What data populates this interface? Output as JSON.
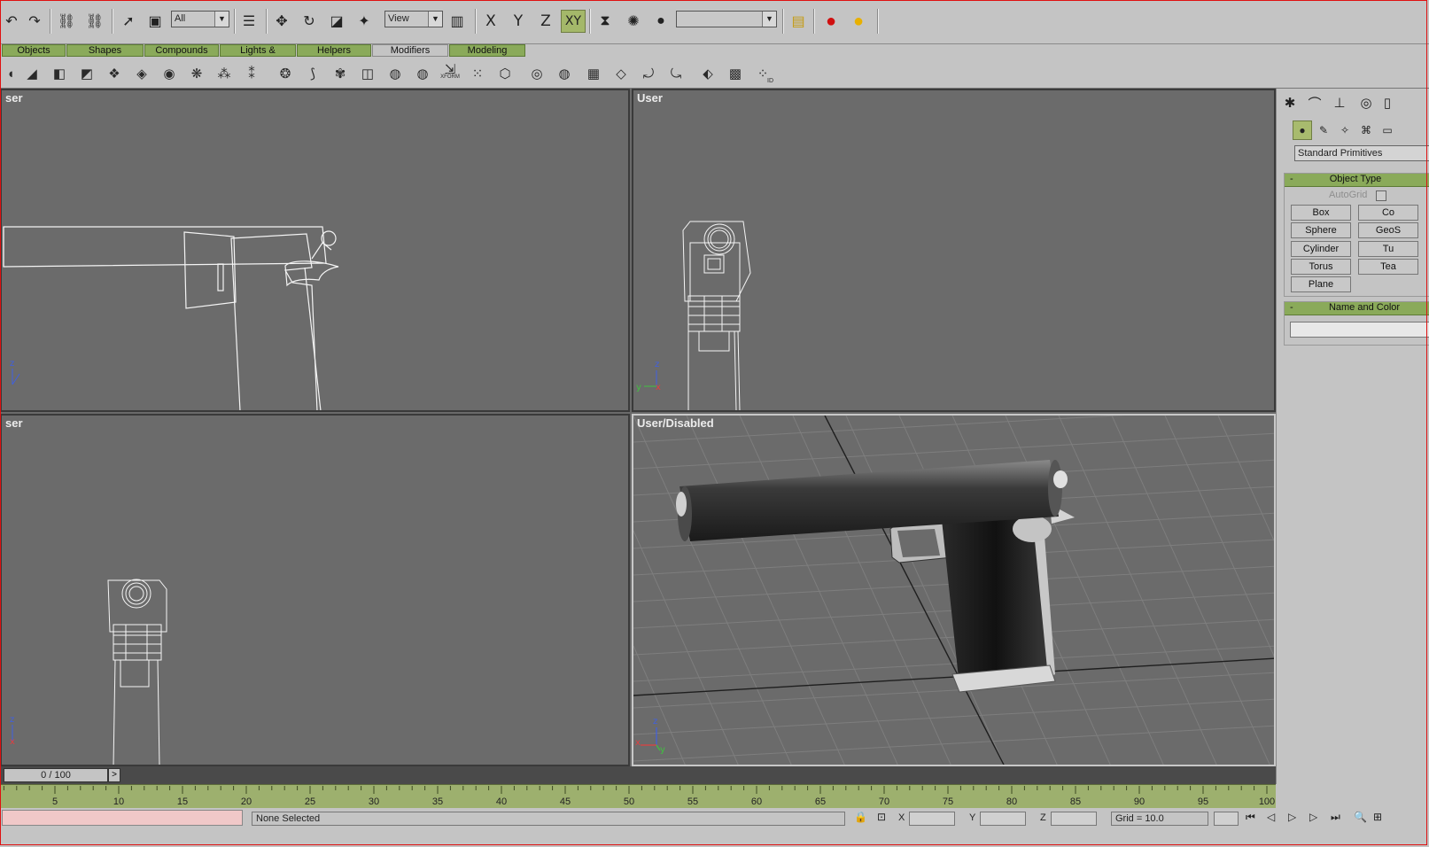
{
  "toolbar": {
    "selection_filter": "All",
    "coord_system": "View",
    "axis_x": "X",
    "axis_y": "Y",
    "axis_z": "Z",
    "axis_xy": "XY",
    "named_selection": ""
  },
  "tabs": [
    {
      "label": "Objects"
    },
    {
      "label": "Shapes"
    },
    {
      "label": "Compounds"
    },
    {
      "label": "Lights & Cameras"
    },
    {
      "label": "Helpers"
    },
    {
      "label": "Modifiers"
    },
    {
      "label": "Modeling"
    }
  ],
  "shelf": {
    "xform_label": "XFORM",
    "id_label": "ID"
  },
  "viewports": {
    "top_left": {
      "label": "ser"
    },
    "top_right": {
      "label": "User"
    },
    "bottom_left": {
      "label": "ser"
    },
    "bottom_right": {
      "label": "User/Disabled"
    }
  },
  "gizmo": {
    "x": "x",
    "y": "y",
    "z": "z"
  },
  "command_panel": {
    "primitive_type": "Standard Primitives",
    "object_type": {
      "title": "Object Type",
      "collapse": "-",
      "autogrid": "AutoGrid",
      "buttons": [
        "Box",
        "Co",
        "Sphere",
        "GeoS",
        "Cylinder",
        "Tu",
        "Torus",
        "Tea",
        "Plane"
      ]
    },
    "name_color": {
      "title": "Name and Color",
      "collapse": "-",
      "name_value": ""
    }
  },
  "timeline": {
    "frame_display": "0 / 100",
    "next": ">"
  },
  "ruler_ticks": [
    "5",
    "10",
    "15",
    "20",
    "25",
    "30",
    "35",
    "40",
    "45",
    "50",
    "55",
    "60",
    "65",
    "70",
    "75",
    "80",
    "85",
    "90",
    "95",
    "100"
  ],
  "status": {
    "selection_text": "None Selected",
    "x_label": "X",
    "y_label": "Y",
    "z_label": "Z",
    "grid_text": "Grid = 10.0"
  },
  "colors": {
    "accent_green": "#8aaa5a",
    "ui_gray": "#c4c4c4",
    "viewport_bg": "#6b6b6b"
  }
}
